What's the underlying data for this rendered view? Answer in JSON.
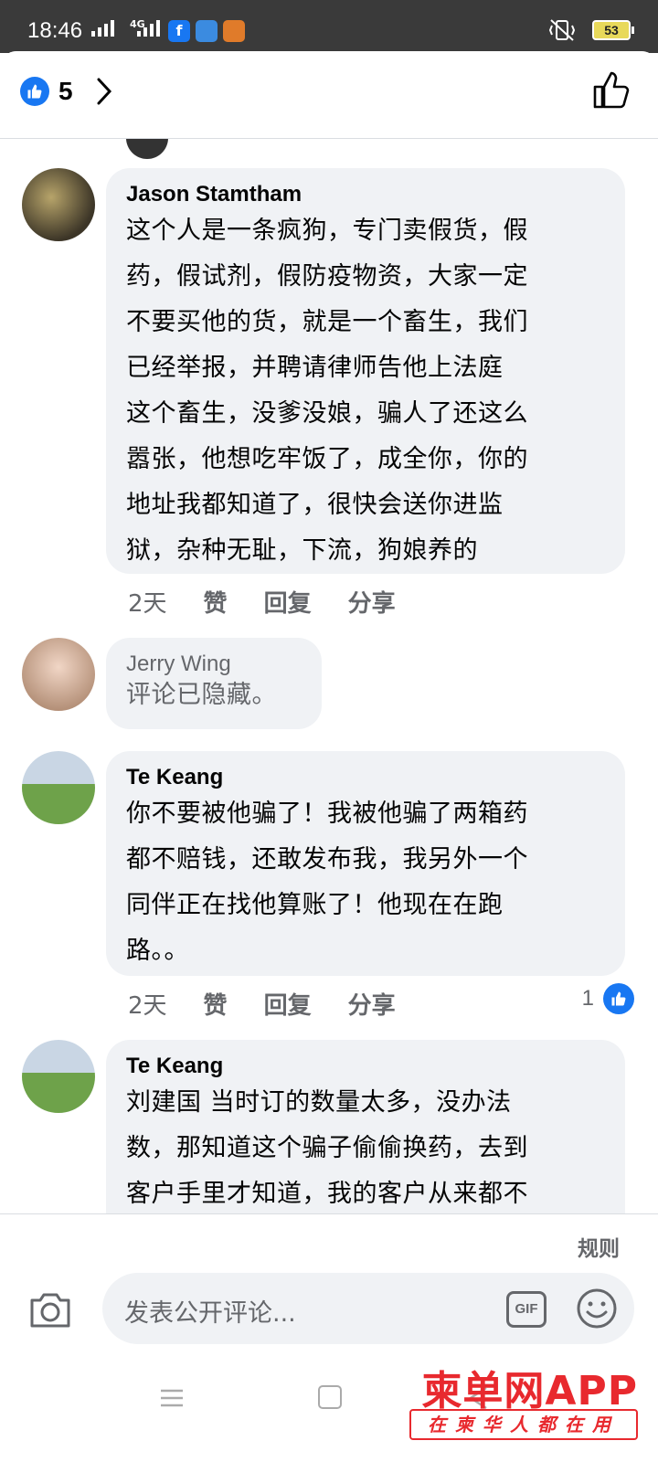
{
  "status_bar": {
    "time": "18:46",
    "network_label": "4G",
    "battery": "53"
  },
  "header": {
    "like_count": "5"
  },
  "comments": [
    {
      "author": "Jason Stamtham",
      "lines": [
        "这个人是一条疯狗，专门卖假货，假",
        "药，假试剂，假防疫物资，大家一定",
        "不要买他的货，就是一个畜生，我们",
        "已经举报，并聘请律师告他上法庭",
        "这个畜生，没爹没娘，骗人了还这么",
        "嚣张，他想吃牢饭了，成全你，你的",
        "地址我都知道了，很快会送你进监",
        "狱，杂种无耻，下流，狗娘养的"
      ],
      "time": "2天",
      "like": "赞",
      "reply": "回复",
      "share": "分享"
    },
    {
      "author": "Jerry Wing",
      "text": "评论已隐藏。"
    },
    {
      "author": "Te Keang",
      "lines": [
        "你不要被他骗了！我被他骗了两箱药",
        "都不赔钱，还敢发布我，我另外一个",
        "同伴正在找他算账了！他现在在跑",
        "路。。"
      ],
      "time": "2天",
      "like": "赞",
      "reply": "回复",
      "share": "分享",
      "reactions": "1"
    },
    {
      "author": "Te Keang",
      "lines": [
        "刘建国 当时订的数量太多，没办法",
        "数，那知道这个骗子偷偷换药，去到",
        "客户手里才知道，我的客户从来都不"
      ]
    }
  ],
  "composer": {
    "rules": "规则",
    "placeholder": "发表公开评论...",
    "gif": "GIF"
  },
  "watermark": {
    "title": "柬单网APP",
    "subtitle": "在柬华人都在用"
  },
  "colors": {
    "facebook_blue": "#1877f2",
    "bubble_bg": "#f0f2f5",
    "muted_text": "#65676b",
    "watermark_red": "#e8292e"
  }
}
